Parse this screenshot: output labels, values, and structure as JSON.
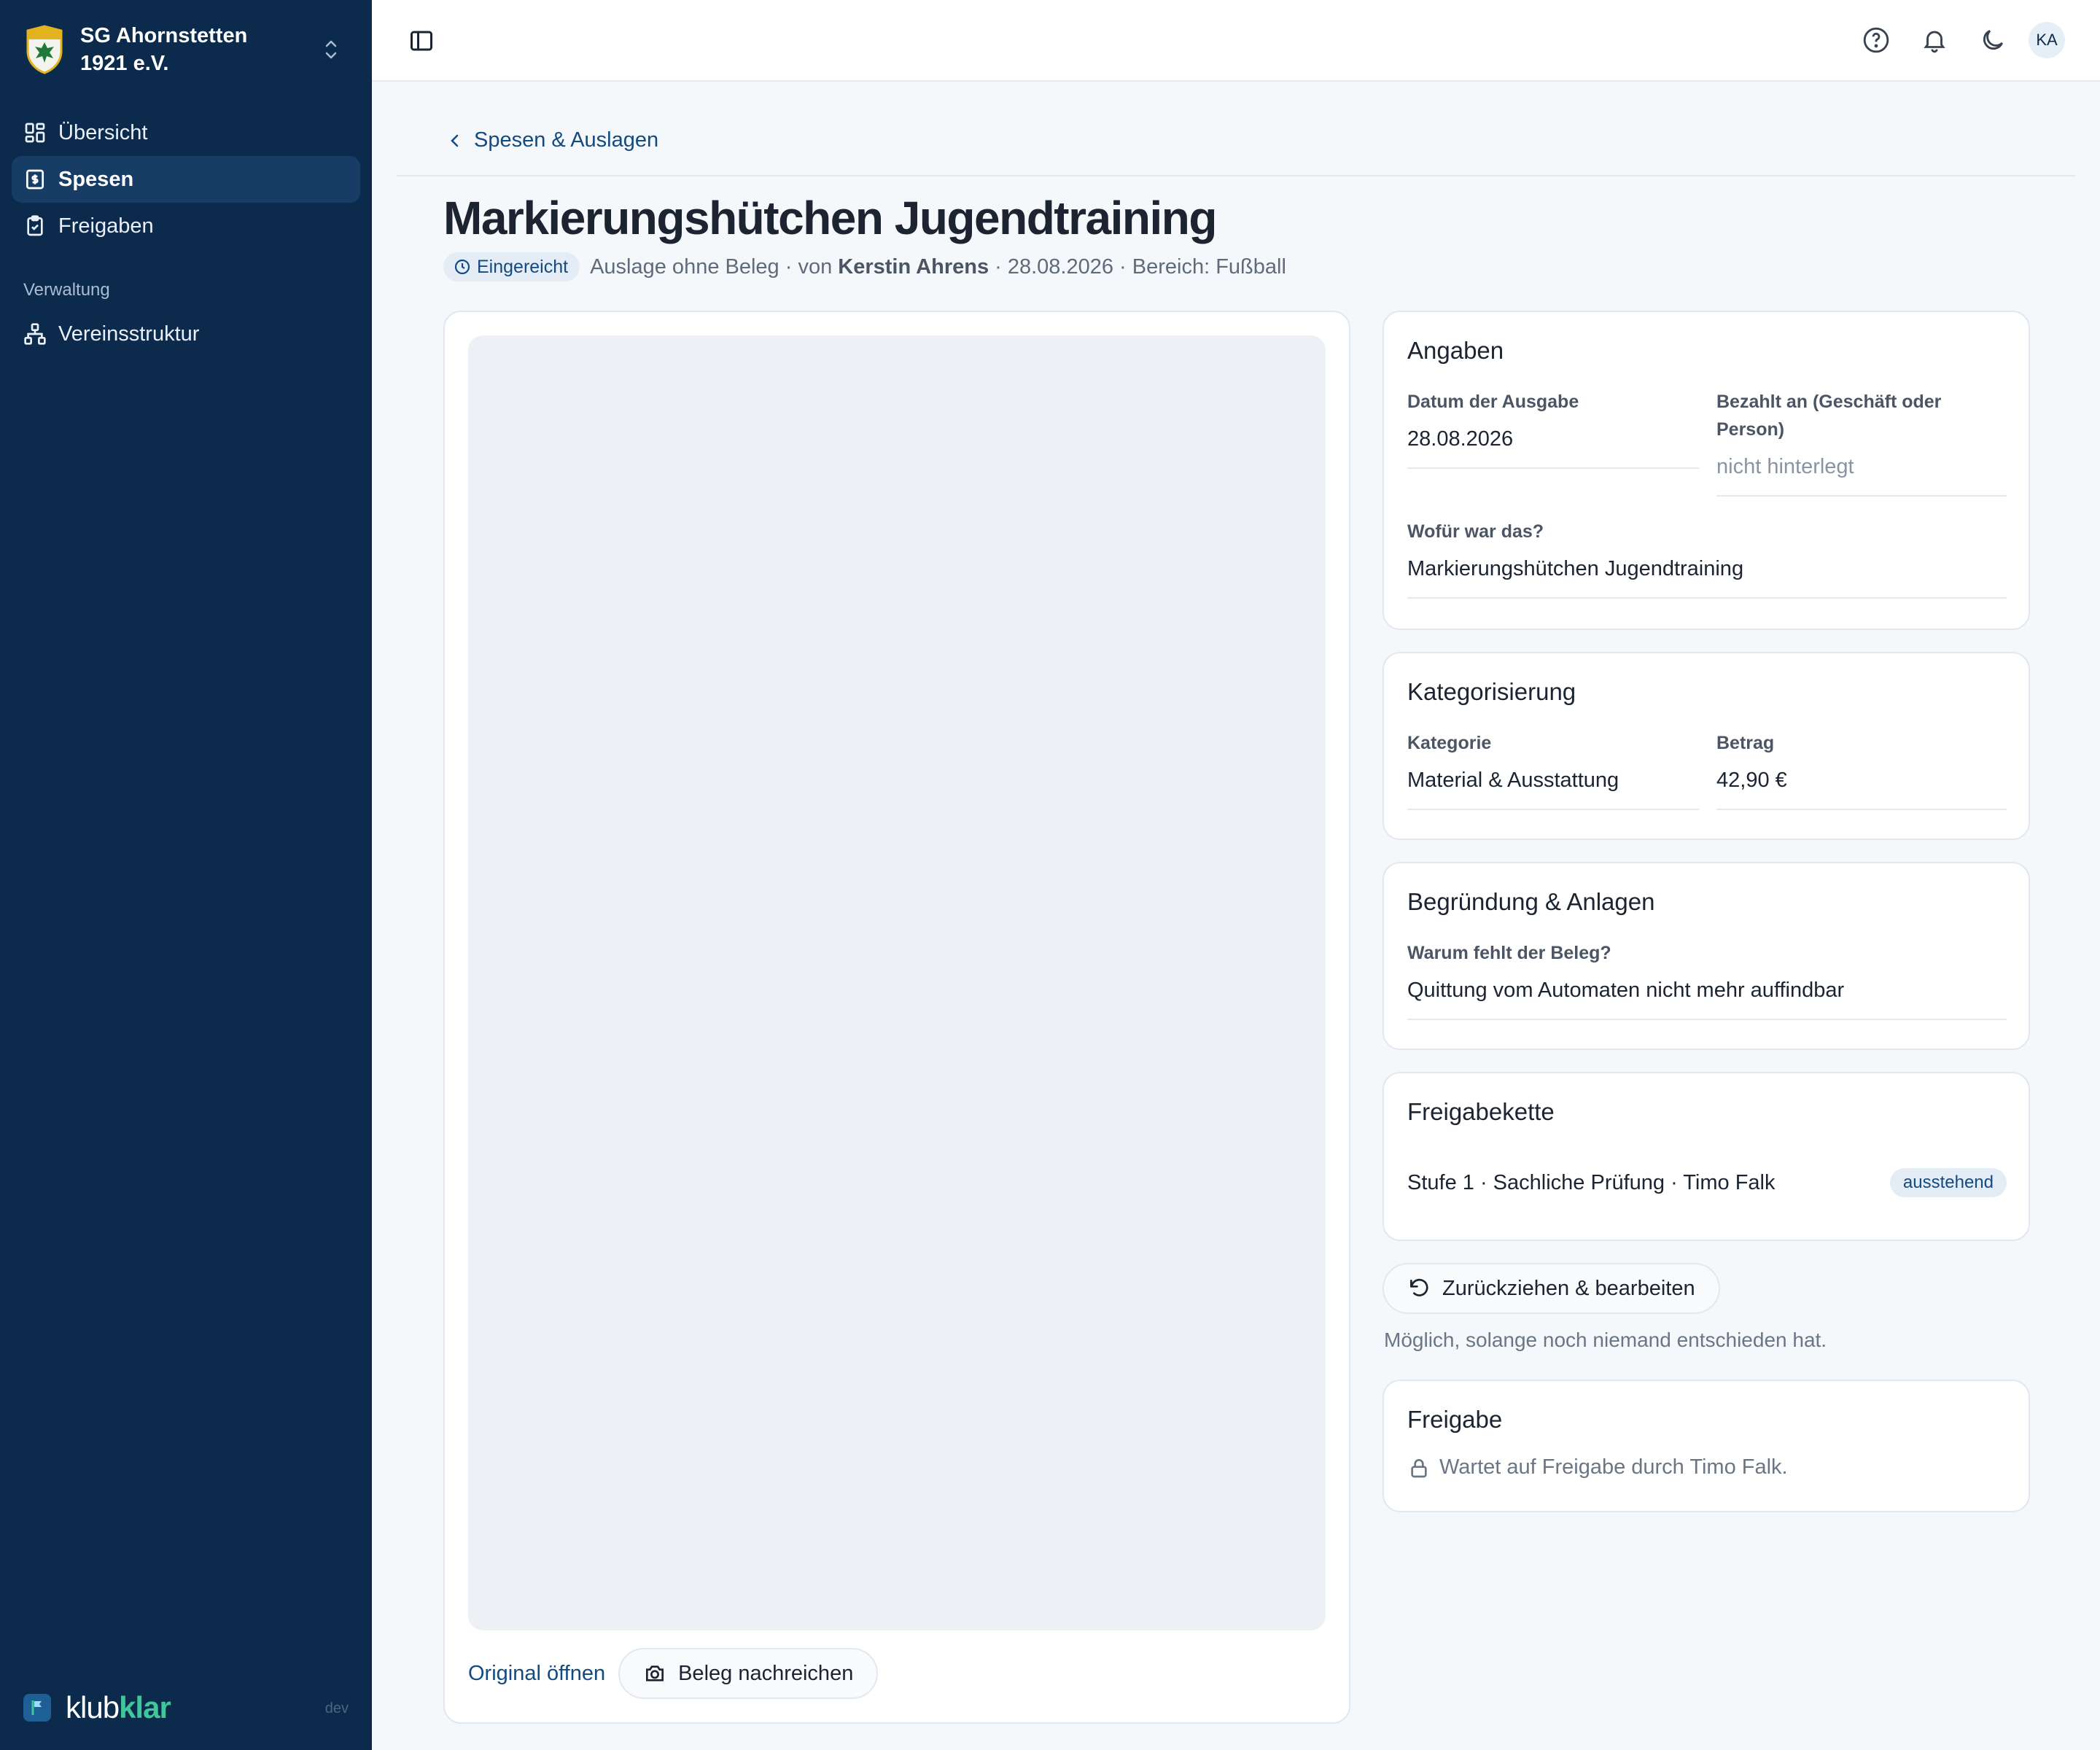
{
  "org": {
    "name": "SG Ahornstetten 1921 e.V."
  },
  "nav": {
    "items": [
      {
        "label": "Übersicht"
      },
      {
        "label": "Spesen"
      },
      {
        "label": "Freigaben"
      }
    ],
    "section_label": "Verwaltung",
    "admin_items": [
      {
        "label": "Vereinsstruktur"
      }
    ]
  },
  "brand": {
    "part1": "klub",
    "part2": "klar",
    "env": "dev"
  },
  "topbar": {
    "avatar_initials": "KA"
  },
  "page": {
    "back_label": "Spesen & Auslagen",
    "title": "Markierungshütchen Jugendtraining",
    "status": "Eingereicht",
    "meta_type": "Auslage ohne Beleg · von ",
    "meta_author": "Kerstin Ahrens",
    "meta_rest": " · 28.08.2026 · Bereich: Fußball"
  },
  "receipt": {
    "open_original": "Original öffnen",
    "upload_button": "Beleg nachreichen"
  },
  "angaben": {
    "title": "Angaben",
    "date_label": "Datum der Ausgabe",
    "date_value": "28.08.2026",
    "payee_label": "Bezahlt an (Geschäft oder Person)",
    "payee_value": "nicht hinterlegt",
    "purpose_label": "Wofür war das?",
    "purpose_value": "Markierungshütchen Jugendtraining"
  },
  "kategorisierung": {
    "title": "Kategorisierung",
    "category_label": "Kategorie",
    "category_value": "Material & Ausstattung",
    "amount_label": "Betrag",
    "amount_value": "42,90 €"
  },
  "begruendung": {
    "title": "Begründung & Anlagen",
    "reason_label": "Warum fehlt der Beleg?",
    "reason_value": "Quittung vom Automaten nicht mehr auffindbar"
  },
  "freigabekette": {
    "title": "Freigabekette",
    "step_prefix": "Stufe 1 · ",
    "step_name": "Sachliche Prüfung",
    "step_suffix": " · Timo Falk",
    "step_status": "ausstehend"
  },
  "withdraw": {
    "button_label": "Zurückziehen & bearbeiten",
    "hint": "Möglich, solange noch niemand entschieden hat."
  },
  "freigabe": {
    "title": "Freigabe",
    "waiting_text": "Wartet auf Freigabe durch Timo Falk."
  },
  "colors": {
    "sidebar": "#0b2a4c",
    "accent": "#134a80",
    "brand_green": "#3fc79a"
  }
}
